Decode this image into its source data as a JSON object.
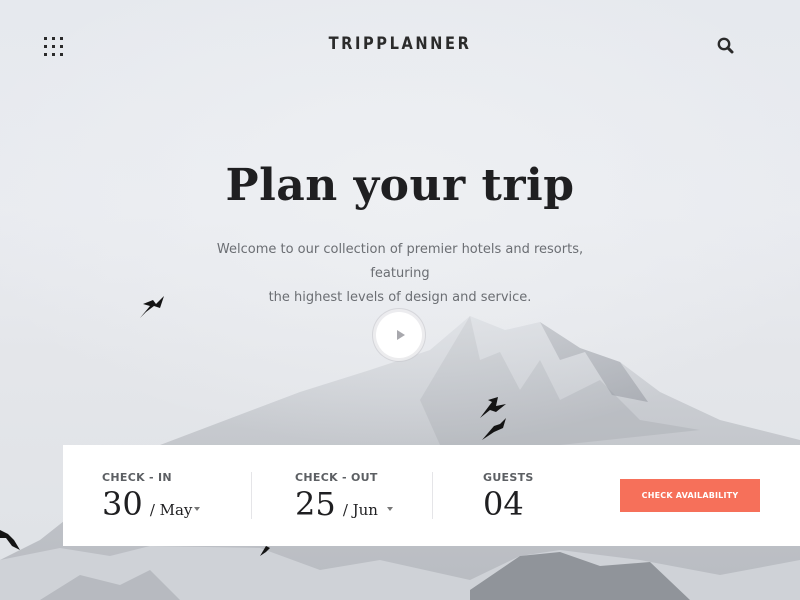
{
  "header": {
    "brand": "TRIPPLANNER",
    "menu_icon": "grid-menu-icon",
    "search_icon": "search-icon"
  },
  "hero": {
    "title": "Plan your trip",
    "subtitle_line1": "Welcome to our collection of premier hotels and resorts, featuring",
    "subtitle_line2": "the highest levels of design and service.",
    "play_icon": "play-icon"
  },
  "booking": {
    "check_in": {
      "label": "CHECK - IN",
      "day": "30",
      "month": "/ May"
    },
    "check_out": {
      "label": "CHECK - OUT",
      "day": "25",
      "month": "/ Jun"
    },
    "guests": {
      "label": "GUESTS",
      "value": "04"
    },
    "cta_label": "CHECK AVAILABILITY"
  },
  "colors": {
    "accent": "#f6705a",
    "text_dark": "#1f1f21"
  }
}
